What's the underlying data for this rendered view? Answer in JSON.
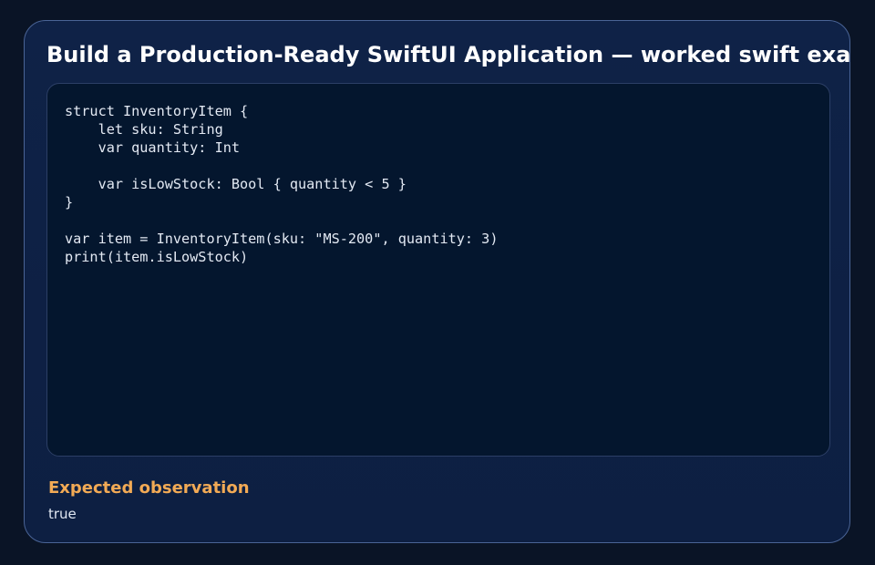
{
  "card": {
    "title": "Build a Production-Ready SwiftUI Application — worked swift example"
  },
  "code": {
    "language": "swift",
    "text": "struct InventoryItem {\n    let sku: String\n    var quantity: Int\n\n    var isLowStock: Bool { quantity < 5 }\n}\n\nvar item = InventoryItem(sku: \"MS-200\", quantity: 3)\nprint(item.isLowStock)"
  },
  "observation": {
    "heading": "Expected observation",
    "value": "true"
  },
  "colors": {
    "background": "#0a1426",
    "card": "#0f2247",
    "card_border": "#4a6496",
    "code_background": "#04162e",
    "heading_accent": "#f2aa55"
  }
}
